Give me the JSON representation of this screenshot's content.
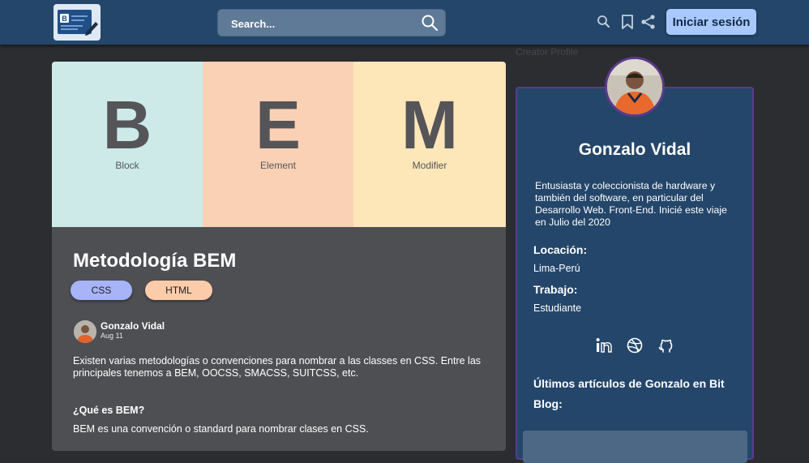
{
  "header": {
    "search_placeholder": "Search...",
    "login_label": "Iniciar sesión",
    "icons": [
      "logo-icon",
      "search-icon",
      "bookmark-icon",
      "share-icon"
    ]
  },
  "article": {
    "cover": [
      {
        "letter": "B",
        "label": "Block",
        "color": "#cdeae8"
      },
      {
        "letter": "E",
        "label": "Element",
        "color": "#fbd1b6"
      },
      {
        "letter": "M",
        "label": "Modifier",
        "color": "#fde6b8"
      }
    ],
    "title": "Metodología BEM",
    "tags": [
      {
        "label": "CSS",
        "color": "#a8b4f8"
      },
      {
        "label": "HTML",
        "color": "#fbcbaa"
      }
    ],
    "author": {
      "name": "Gonzalo Vidal",
      "date": "Aug 11"
    },
    "intro": "Existen varias metodologías o convenciones para nombrar a las classes en CSS. Entre las principales tenemos a BEM, OOCSS, SMACSS, SUITCSS, etc.",
    "subtitle": "¿Qué es BEM?",
    "text": "BEM es una convención o standard para nombrar clases en CSS."
  },
  "sidebar": {
    "image_alt": "Creator Profile",
    "name": "Gonzalo Vidal",
    "bio": "Entusiasta y coleccionista de hardware y también del software, en particular del Desarrollo Web. Front-End. Inicié este viaje en Julio del 2020",
    "location_label": "Locación:",
    "location": "Lima-Perú",
    "job_label": "Trabajo:",
    "job": "Estudiante",
    "social_icons": [
      "linkedin-icon",
      "dribbble-icon",
      "github-icon"
    ],
    "recent_title": "Últimos artículos de Gonzalo en Bit Blog:"
  },
  "colors": {
    "header_bg": "#24466a",
    "page_bg": "#2b2d31",
    "article_bg": "#4e4f53",
    "card_border": "#5c3a8c",
    "login_bg": "#a9c8fb"
  }
}
